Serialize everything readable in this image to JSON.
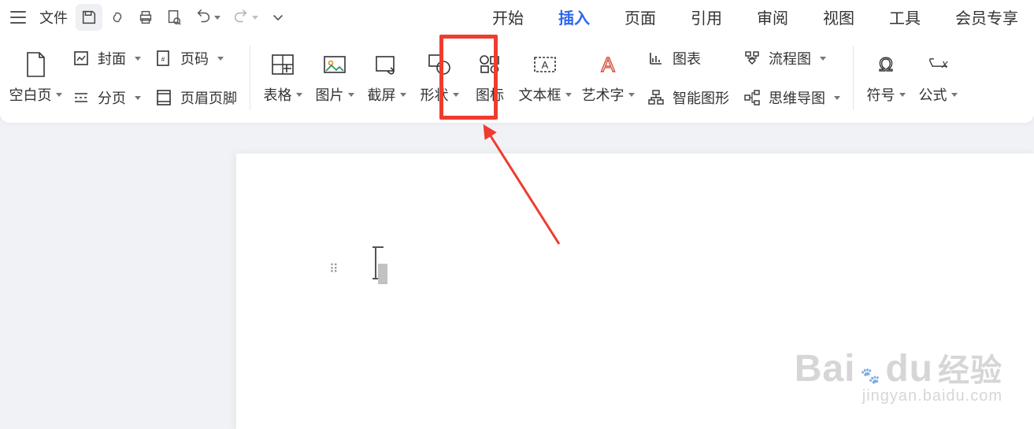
{
  "title_bar": {
    "file_label": "文件"
  },
  "tabs": {
    "start": "开始",
    "insert": "插入",
    "page": "页面",
    "reference": "引用",
    "review": "审阅",
    "view": "视图",
    "tools": "工具",
    "member": "会员专享"
  },
  "ribbon": {
    "blank_page": "空白页",
    "cover": "封面",
    "page_break": "分页",
    "page_number": "页码",
    "header_footer": "页眉页脚",
    "table": "表格",
    "picture": "图片",
    "screenshot": "截屏",
    "shapes": "形状",
    "icon": "图标",
    "textbox": "文本框",
    "wordart": "艺术字",
    "chart": "图表",
    "smartart": "智能图形",
    "flowchart": "流程图",
    "mindmap": "思维导图",
    "symbol": "符号",
    "equation": "公式"
  },
  "watermark": {
    "brand": "Bai",
    "brand2": "du",
    "word": "经验",
    "url": "jingyan.baidu.com"
  }
}
